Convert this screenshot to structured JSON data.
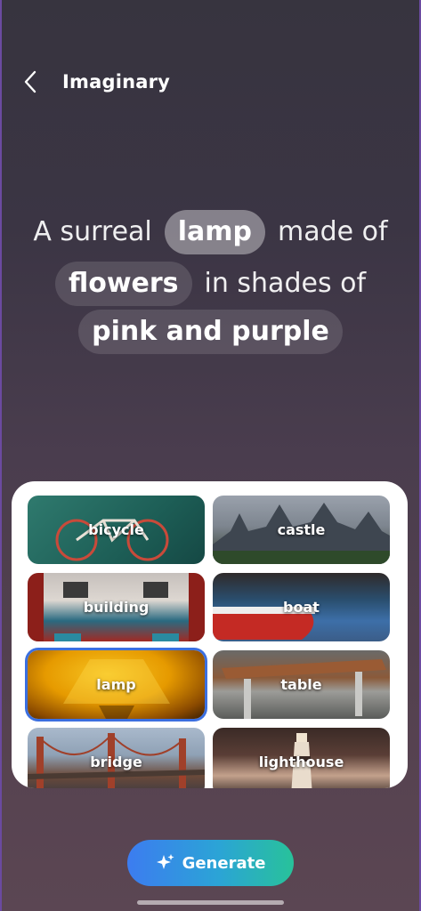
{
  "header": {
    "title": "Imaginary",
    "back_icon": "chevron-left-icon"
  },
  "prompt": {
    "line1": {
      "before": "A surreal",
      "chip": "lamp",
      "after": "made of"
    },
    "line2": {
      "chip": "flowers",
      "after": "in shades of"
    },
    "line3": {
      "chip": "pink and purple"
    }
  },
  "options": [
    {
      "label": "bicycle"
    },
    {
      "label": "castle"
    },
    {
      "label": "building"
    },
    {
      "label": "boat"
    },
    {
      "label": "lamp",
      "selected": true
    },
    {
      "label": "table"
    },
    {
      "label": "bridge"
    },
    {
      "label": "lighthouse"
    }
  ],
  "generate": {
    "label": "Generate",
    "icon": "sparkles-icon"
  },
  "colors": {
    "accent": "#3b6fe0",
    "button_start": "#3c7cf0",
    "button_end": "#28c29a"
  }
}
